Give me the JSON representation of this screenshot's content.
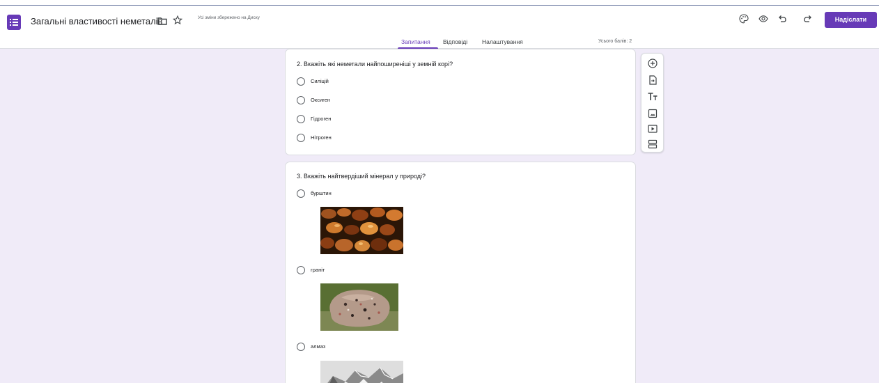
{
  "app": {
    "title": "Загальні властивості неметалів",
    "saved_note": "Усі зміни збережено на Диску",
    "send_label": "Надіслати",
    "accent": "#673ab7"
  },
  "icons": {
    "form": "form-list-icon",
    "folder": "folder-icon",
    "star": "star-icon",
    "palette": "palette-icon",
    "preview": "eye-icon",
    "undo": "undo-icon",
    "redo": "redo-icon",
    "add_question": "add-circle-icon",
    "import_questions": "import-icon",
    "add_title": "title-text-icon",
    "add_image": "image-icon",
    "add_video": "video-icon",
    "add_section": "section-icon"
  },
  "tabs": [
    {
      "label": "Запитання",
      "active": true
    },
    {
      "label": "Відповіді",
      "active": false
    },
    {
      "label": "Налаштування",
      "active": false
    }
  ],
  "total_points": "Усього балів: 2",
  "questions": [
    {
      "title": "2. Вкажіть які неметали  найпоширеніші у земній корі?",
      "options": [
        "Силіцій",
        "Оксиген",
        "Гідроген",
        "Нітроген"
      ]
    },
    {
      "title": "3. Вкажіть найтвердіший мінерал у природі?",
      "options": [
        "бурштин",
        "граніт",
        "алмаз"
      ]
    }
  ]
}
